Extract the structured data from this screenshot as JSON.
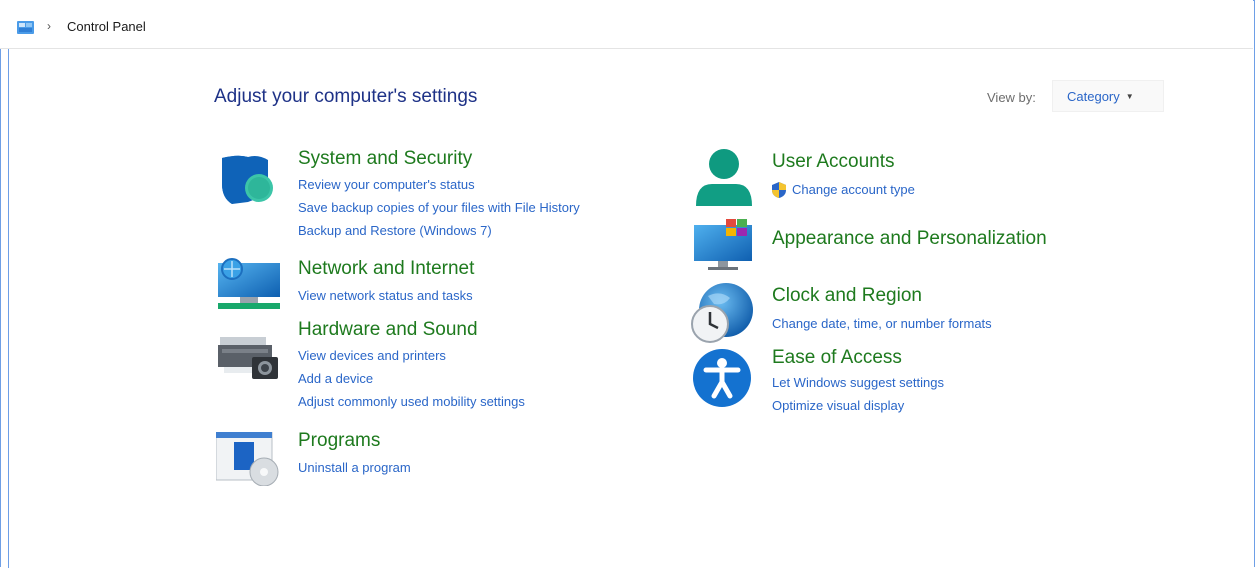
{
  "address": {
    "separator": "›",
    "location": "Control Panel"
  },
  "header": {
    "title": "Adjust your computer's settings",
    "view_by_label": "View by:",
    "view_by_value": "Category"
  },
  "categories": {
    "system_security": {
      "title": "System and Security",
      "icon": "shield-icon",
      "links": [
        "Review your computer's status",
        "Save backup copies of your files with File History",
        "Backup and Restore (Windows 7)"
      ]
    },
    "network": {
      "title": "Network and Internet",
      "icon": "network-icon",
      "links": [
        "View network status and tasks"
      ]
    },
    "hardware": {
      "title": "Hardware and Sound",
      "icon": "printer-icon",
      "links": [
        "View devices and printers",
        "Add a device",
        "Adjust commonly used mobility settings"
      ]
    },
    "programs": {
      "title": "Programs",
      "icon": "programs-icon",
      "links": [
        "Uninstall a program"
      ]
    },
    "user_accounts": {
      "title": "User Accounts",
      "icon": "user-icon",
      "links": [
        "Change account type"
      ]
    },
    "appearance": {
      "title": "Appearance and Personalization",
      "icon": "monitor-icon",
      "links": []
    },
    "clock": {
      "title": "Clock and Region",
      "icon": "clock-globe-icon",
      "links": [
        "Change date, time, or number formats"
      ]
    },
    "ease": {
      "title": "Ease of Access",
      "icon": "accessibility-icon",
      "links": [
        "Let Windows suggest settings",
        "Optimize visual display"
      ]
    }
  },
  "colors": {
    "title_blue": "#1e3287",
    "category_green": "#1e7a1e",
    "link_blue": "#2a66c8",
    "frame_border": "#6e9fe6"
  }
}
